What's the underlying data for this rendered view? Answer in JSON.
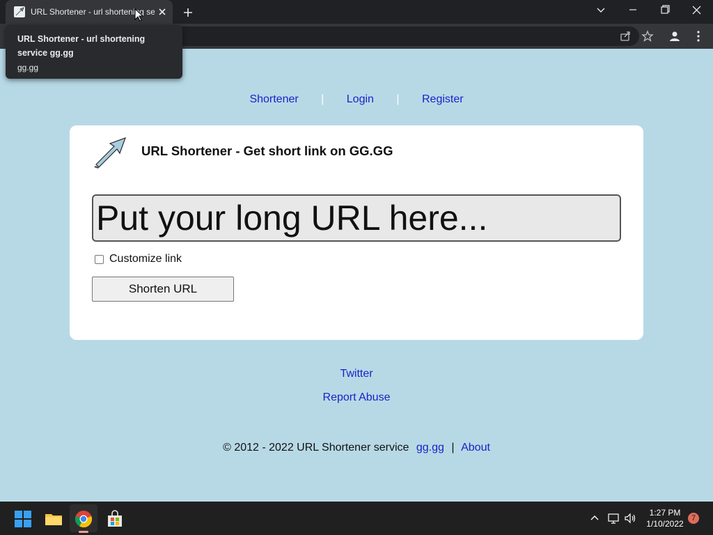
{
  "browser": {
    "tab_title": "URL Shortener - url shortening se",
    "tooltip": {
      "title": "URL Shortener - url shortening service gg.gg",
      "url": "gg.gg"
    }
  },
  "nav": {
    "items": [
      "Shortener",
      "Login",
      "Register"
    ],
    "separator": "|"
  },
  "card": {
    "title": "URL Shortener - Get short link on GG.GG",
    "input_placeholder": "Put your long URL here...",
    "customize_label": "Customize link",
    "customize_checked": false,
    "button_label": "Shorten URL"
  },
  "footer": {
    "links": [
      "Twitter",
      "Report Abuse"
    ],
    "copyright": "© 2012 - 2022 URL Shortener service",
    "site_link": "gg.gg",
    "separator": "|",
    "about": "About"
  },
  "taskbar": {
    "time": "1:27 PM",
    "date": "1/10/2022",
    "notification_count": "7"
  },
  "colors": {
    "page_background": "#b7d9e6",
    "link": "#1a22c9",
    "card_background": "#ffffff"
  }
}
